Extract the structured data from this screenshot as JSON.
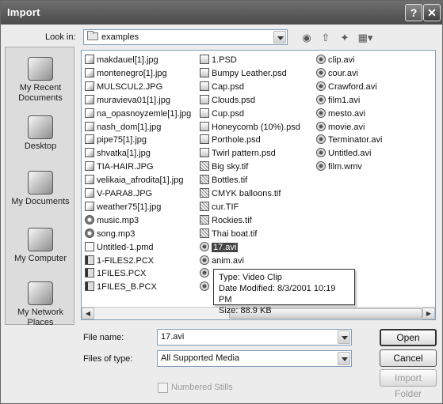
{
  "window": {
    "title": "Import",
    "help_label": "?",
    "close_label": "✕"
  },
  "lookin": {
    "label": "Look in:",
    "value": "examples"
  },
  "places": [
    "My Recent Documents",
    "Desktop",
    "My Documents",
    "My Computer",
    "My Network Places"
  ],
  "files": {
    "col1": [
      {
        "name": "makdauel[1].jpg",
        "type": "jpg"
      },
      {
        "name": "montenegro[1].jpg",
        "type": "jpg"
      },
      {
        "name": "MULSCUL2.JPG",
        "type": "jpg"
      },
      {
        "name": "muravieva01[1].jpg",
        "type": "jpg"
      },
      {
        "name": "na_opasnoyzemle[1].jpg",
        "type": "jpg"
      },
      {
        "name": "nash_dom[1].jpg",
        "type": "jpg"
      },
      {
        "name": "pipe75[1].jpg",
        "type": "jpg"
      },
      {
        "name": "shvatka[1].jpg",
        "type": "jpg"
      },
      {
        "name": "TIA-HAIR.JPG",
        "type": "jpg"
      },
      {
        "name": "velikaia_afrodita[1].jpg",
        "type": "jpg"
      },
      {
        "name": "V-PARA8.JPG",
        "type": "jpg"
      },
      {
        "name": "weather75[1].jpg",
        "type": "jpg"
      },
      {
        "name": "music.mp3",
        "type": "mp3"
      },
      {
        "name": "song.mp3",
        "type": "mp3"
      },
      {
        "name": "Untitled-1.pmd",
        "type": "pmd"
      },
      {
        "name": "1-FILES2.PCX",
        "type": "pcx"
      },
      {
        "name": "1FILES.PCX",
        "type": "pcx"
      },
      {
        "name": "1FILES_B.PCX",
        "type": "pcx"
      }
    ],
    "col2": [
      {
        "name": "1.PSD",
        "type": "psd"
      },
      {
        "name": "Bumpy Leather.psd",
        "type": "psd"
      },
      {
        "name": "Cap.psd",
        "type": "psd"
      },
      {
        "name": "Clouds.psd",
        "type": "psd"
      },
      {
        "name": "Cup.psd",
        "type": "psd"
      },
      {
        "name": "Honeycomb (10%).psd",
        "type": "psd"
      },
      {
        "name": "Porthole.psd",
        "type": "psd"
      },
      {
        "name": "Twirl pattern.psd",
        "type": "psd"
      },
      {
        "name": "Big sky.tif",
        "type": "tif"
      },
      {
        "name": "Bottles.tif",
        "type": "tif"
      },
      {
        "name": "CMYK balloons.tif",
        "type": "tif"
      },
      {
        "name": "cur.TIF",
        "type": "tif"
      },
      {
        "name": "Rockies.tif",
        "type": "tif"
      },
      {
        "name": "Thai boat.tif",
        "type": "tif"
      },
      {
        "name": "17.avi",
        "type": "avi",
        "selected": true
      },
      {
        "name": "anim.avi",
        "type": "avi"
      },
      {
        "name": "",
        "type": "avi"
      },
      {
        "name": "",
        "type": "avi"
      }
    ],
    "col3": [
      {
        "name": "clip.avi",
        "type": "avi"
      },
      {
        "name": "cour.avi",
        "type": "avi"
      },
      {
        "name": "Crawford.avi",
        "type": "avi"
      },
      {
        "name": "film1.avi",
        "type": "avi"
      },
      {
        "name": "mesto.avi",
        "type": "avi"
      },
      {
        "name": "movie.avi",
        "type": "avi"
      },
      {
        "name": "Terminator.avi",
        "type": "avi"
      },
      {
        "name": "Untitled.avi",
        "type": "avi"
      },
      {
        "name": "film.wmv",
        "type": "avi"
      }
    ]
  },
  "tooltip": {
    "type": "Type: Video Clip",
    "modified": "Date Modified: 8/3/2001 10:19 PM",
    "size": "Size: 88.9 KB"
  },
  "filename": {
    "label": "File name:",
    "value": "17.avi"
  },
  "filetype": {
    "label": "Files of type:",
    "value": "All Supported Media"
  },
  "buttons": {
    "open": "Open",
    "cancel": "Cancel",
    "import_folder": "Import Folder"
  },
  "numbered_stills": {
    "label": "Numbered Stills",
    "checked": false
  }
}
